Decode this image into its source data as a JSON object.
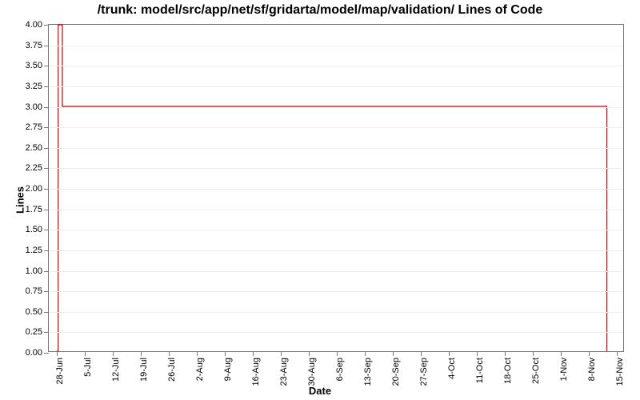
{
  "chart_data": {
    "type": "line",
    "title": "/trunk: model/src/app/net/sf/gridarta/model/map/validation/ Lines of Code",
    "xlabel": "Date",
    "ylabel": "Lines",
    "ylim": [
      0,
      4.0
    ],
    "y_ticks": [
      0.0,
      0.25,
      0.5,
      0.75,
      1.0,
      1.25,
      1.5,
      1.75,
      2.0,
      2.25,
      2.5,
      2.75,
      3.0,
      3.25,
      3.5,
      3.75,
      4.0
    ],
    "x_ticks": [
      "28-Jun",
      "5-Jul",
      "12-Jul",
      "19-Jul",
      "26-Jul",
      "2-Aug",
      "9-Aug",
      "16-Aug",
      "23-Aug",
      "30-Aug",
      "6-Sep",
      "13-Sep",
      "20-Sep",
      "27-Sep",
      "4-Oct",
      "11-Oct",
      "18-Oct",
      "25-Oct",
      "1-Nov",
      "8-Nov",
      "15-Nov"
    ],
    "series": [
      {
        "name": "Lines of Code",
        "color": "#cc0000",
        "points": [
          {
            "x_index_frac": 0.0,
            "y": 0
          },
          {
            "x_index_frac": 0.05,
            "y": 0
          },
          {
            "x_index_frac": 0.05,
            "y": 4
          },
          {
            "x_index_frac": 0.2,
            "y": 4
          },
          {
            "x_index_frac": 0.2,
            "y": 3
          },
          {
            "x_index_frac": 19.7,
            "y": 3
          },
          {
            "x_index_frac": 19.7,
            "y": 0
          }
        ]
      }
    ]
  }
}
